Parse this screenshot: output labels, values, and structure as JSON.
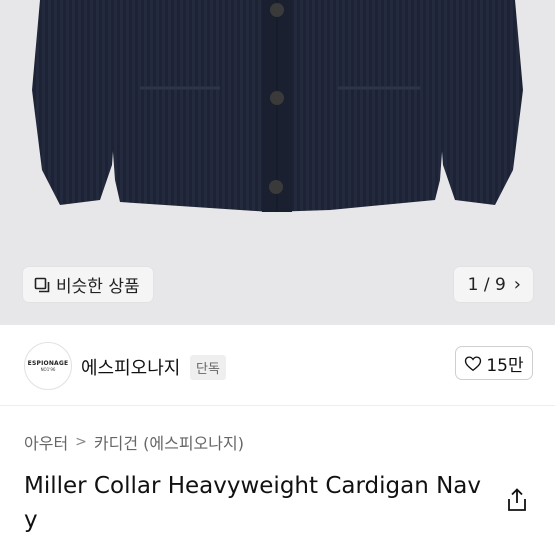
{
  "hero": {
    "similar_label": "비슷한 상품",
    "similar_icon": "square-stack-icon",
    "pager_text": "1 / 9",
    "pager_icon": "chevron-right-icon"
  },
  "seller": {
    "avatar_line1": "ESPIONAGE",
    "avatar_line2": "NO1'96",
    "name": "에스피오나지",
    "badge": "단독",
    "likes_label": "15만",
    "like_icon": "heart-icon"
  },
  "breadcrumb": {
    "items": [
      "아우터",
      "카디건 (에스피오나지)"
    ],
    "separator_icon": "chevron-right-icon"
  },
  "product": {
    "title": "Miller Collar Heavyweight Cardigan Navy",
    "share_icon": "share-icon"
  },
  "colors": {
    "hero_bg": "#e7e7e9",
    "sweater_navy": "#1c2233"
  }
}
